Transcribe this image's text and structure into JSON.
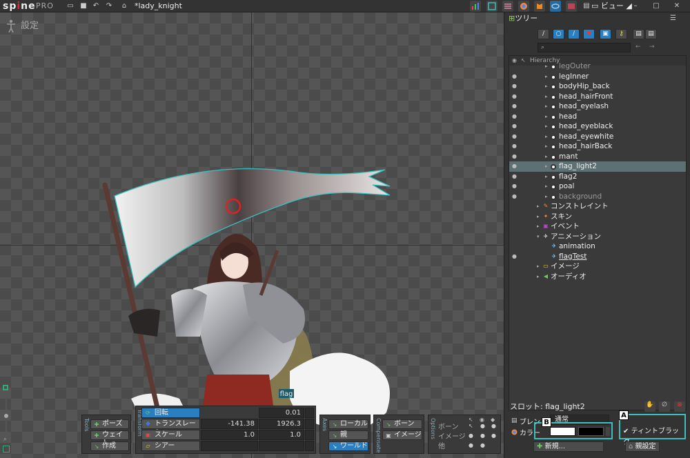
{
  "app": {
    "logo": "spine",
    "edition": "PRO",
    "project_title": "*lady_knight",
    "view_menu": "ビュー"
  },
  "viewport": {
    "mode_label": "設定",
    "bone_tag": "flag"
  },
  "tools": {
    "section_label": "Tools",
    "items": [
      {
        "label": "ポーズ",
        "icon": "pose-icon",
        "active": false
      },
      {
        "label": "ウェイト",
        "icon": "weight-icon",
        "active": false
      },
      {
        "label": "作成",
        "icon": "create-icon",
        "active": false
      }
    ]
  },
  "transform": {
    "section_label": "Transform",
    "rows": [
      {
        "label": "回転",
        "value1": "0.01",
        "value2": "",
        "active": true
      },
      {
        "label": "トランスレート",
        "value1": "-141.38",
        "value2": "1926.3",
        "active": false
      },
      {
        "label": "スケール",
        "value1": "1.0",
        "value2": "1.0",
        "active": false
      },
      {
        "label": "シアー",
        "value1": "",
        "value2": "",
        "active": false
      }
    ]
  },
  "axes": {
    "section_label": "Axes",
    "items": [
      {
        "label": "ローカル",
        "active": false
      },
      {
        "label": "親",
        "active": false
      },
      {
        "label": "ワールド",
        "active": true
      }
    ]
  },
  "compensate": {
    "section_label": "Compensate",
    "items": [
      {
        "label": "ボーン",
        "active": false
      },
      {
        "label": "イメージ",
        "active": false
      }
    ]
  },
  "options": {
    "section_label": "Options",
    "rows": [
      "ボーン",
      "イメージ",
      "他"
    ]
  },
  "tree": {
    "title": "ツリー",
    "hierarchy_label": "Hierarchy",
    "search_placeholder": "",
    "rows": [
      {
        "label": "legOuter",
        "kind": "slot",
        "eye": false,
        "dim": true
      },
      {
        "label": "legInner",
        "kind": "slot",
        "eye": true,
        "dim": false
      },
      {
        "label": "bodyHip_back",
        "kind": "slot",
        "eye": true,
        "dim": false
      },
      {
        "label": "head_hairFront",
        "kind": "slot",
        "eye": true,
        "dim": false
      },
      {
        "label": "head_eyelash",
        "kind": "slot",
        "eye": true,
        "dim": false
      },
      {
        "label": "head",
        "kind": "slot",
        "eye": true,
        "dim": false
      },
      {
        "label": "head_eyeblack",
        "kind": "slot",
        "eye": true,
        "dim": false
      },
      {
        "label": "head_eyewhite",
        "kind": "slot",
        "eye": true,
        "dim": false
      },
      {
        "label": "head_hairBack",
        "kind": "slot",
        "eye": true,
        "dim": false
      },
      {
        "label": "mant",
        "kind": "slot",
        "eye": true,
        "dim": false
      },
      {
        "label": "flag_light2",
        "kind": "slot",
        "eye": true,
        "dim": false,
        "selected": true
      },
      {
        "label": "flag2",
        "kind": "slot",
        "eye": true,
        "dim": false
      },
      {
        "label": "poal",
        "kind": "slot",
        "eye": true,
        "dim": false
      },
      {
        "label": "background",
        "kind": "slot",
        "eye": true,
        "dim": true
      },
      {
        "label": "コンストレイント",
        "kind": "group-constraint",
        "eye": false,
        "dim": false
      },
      {
        "label": "スキン",
        "kind": "group-skin",
        "eye": false,
        "dim": false
      },
      {
        "label": "イベント",
        "kind": "group-event",
        "eye": false,
        "dim": false
      },
      {
        "label": "アニメーション",
        "kind": "group-animation",
        "eye": false,
        "dim": false
      },
      {
        "label": "animation",
        "kind": "anim",
        "eye": false,
        "dim": false
      },
      {
        "label": "flagTest",
        "kind": "anim",
        "eye": true,
        "dim": false,
        "underline": true
      },
      {
        "label": "イメージ",
        "kind": "group-image",
        "eye": false,
        "dim": false
      },
      {
        "label": "オーディオ",
        "kind": "group-audio",
        "eye": false,
        "dim": false
      }
    ]
  },
  "slot_panel": {
    "title": "スロット: flag_light2",
    "blend_label": "ブレンド",
    "blend_value": "通常",
    "color_label": "カラー",
    "tint_black_label": "ティントブラック",
    "new_button": "新規...",
    "bind_button": "親設定",
    "light_color": "#ffffff",
    "dark_color": "#000000"
  },
  "annotations": {
    "a": "A",
    "b": "B"
  },
  "colors": {
    "accent": "#2a7fc0",
    "selection": "#5d7074",
    "callout": "#3bbfbf"
  }
}
